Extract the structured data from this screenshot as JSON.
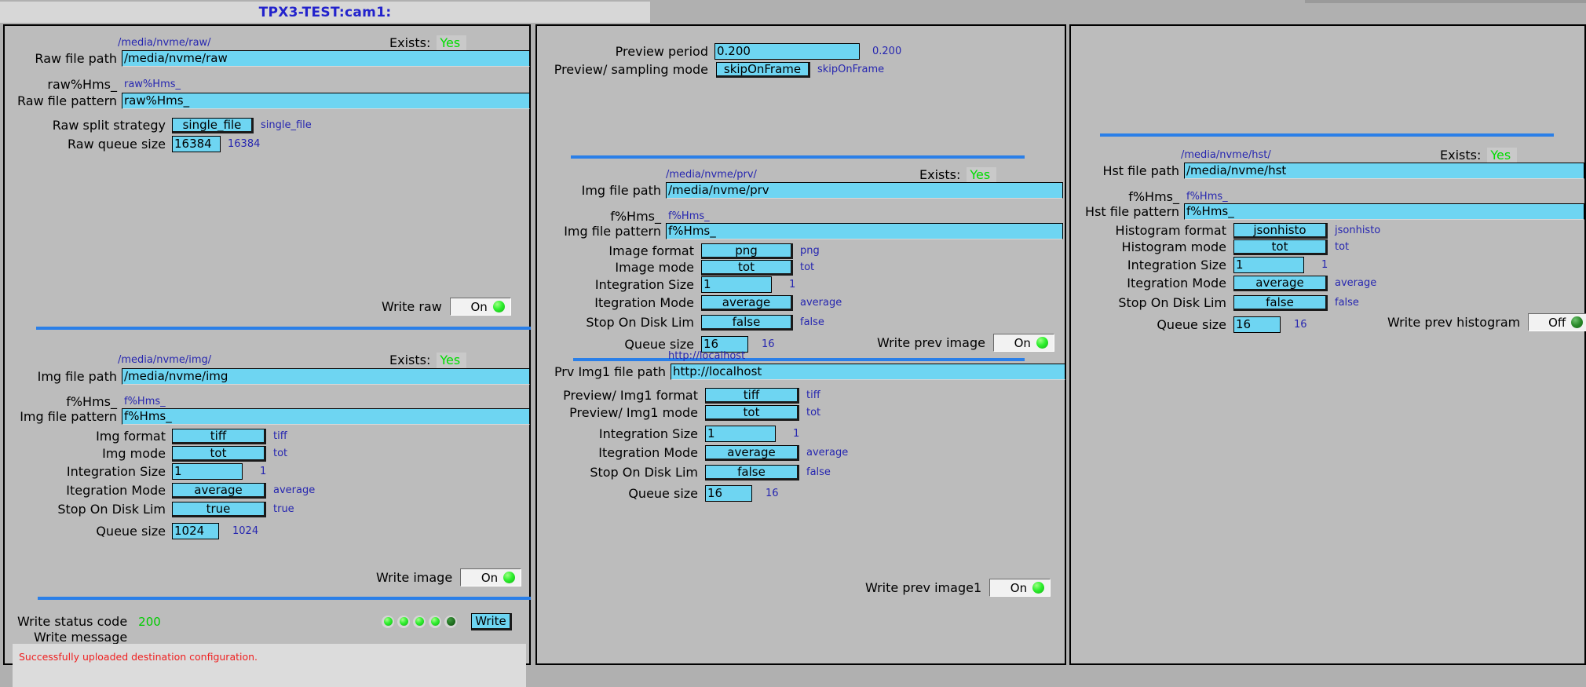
{
  "window": {
    "title": "TPX3-TEST:cam1:"
  },
  "raw_panel": {
    "raw_section": {
      "path_hint": "/media/nvme/raw/",
      "exists_label": "Exists:",
      "exists_value": "Yes",
      "file_path_label": "Raw file path",
      "file_path_value": "/media/nvme/raw",
      "pattern_hint_label": "raw%Hms_",
      "pattern_hint_echo": "raw%Hms_",
      "pattern_label": "Raw file pattern",
      "pattern_value": "raw%Hms_",
      "split_label": "Raw split strategy",
      "split_value": "single_file",
      "split_echo": "single_file",
      "queue_label": "Raw queue size",
      "queue_value": "16384",
      "queue_echo": "16384",
      "write_label": "Write raw",
      "write_state": "On"
    },
    "img_section": {
      "path_hint": "/media/nvme/img/",
      "exists_label": "Exists:",
      "exists_value": "Yes",
      "file_path_label": "Img file path",
      "file_path_value": "/media/nvme/img",
      "pattern_hint_label": "f%Hms_",
      "pattern_hint_echo": "f%Hms_",
      "pattern_label": "Img file pattern",
      "pattern_value": "f%Hms_",
      "format_label": "Img format",
      "format_value": "tiff",
      "format_echo": "tiff",
      "mode_label": "Img mode",
      "mode_value": "tot",
      "mode_echo": "tot",
      "integration_size_label": "Integration Size",
      "integration_size_value": "1",
      "integration_size_echo": "1",
      "integration_mode_label": "Itegration Mode",
      "integration_mode_value": "average",
      "integration_mode_echo": "average",
      "stop_label": "Stop On Disk Lim",
      "stop_value": "true",
      "stop_echo": "true",
      "queue_label": "Queue size",
      "queue_value": "1024",
      "queue_echo": "1024",
      "write_label": "Write image",
      "write_state": "On"
    },
    "status": {
      "code_label": "Write status code",
      "code_value": "200",
      "message_label": "Write message",
      "message_value": "Successfully uploaded destination configuration.",
      "leds": [
        "bright",
        "bright",
        "bright",
        "bright",
        "dim"
      ],
      "write_button": "Write"
    }
  },
  "prv_panel": {
    "preview": {
      "period_label": "Preview period",
      "period_value": "0.200",
      "period_echo": "0.200",
      "sampling_label": "Preview/ sampling mode",
      "sampling_value": "skipOnFrame",
      "sampling_echo": "skipOnFrame"
    },
    "img_section": {
      "path_hint": "/media/nvme/prv/",
      "exists_label": "Exists:",
      "exists_value": "Yes",
      "file_path_label": "Img file path",
      "file_path_value": "/media/nvme/prv",
      "pattern_hint_label": "f%Hms_",
      "pattern_hint_echo": "f%Hms_",
      "pattern_label": "Img file pattern",
      "pattern_value": "f%Hms_",
      "format_label": "Image format",
      "format_value": "png",
      "format_echo": "png",
      "mode_label": "Image mode",
      "mode_value": "tot",
      "mode_echo": "tot",
      "integration_size_label": "Integration Size",
      "integration_size_value": "1",
      "integration_size_echo": "1",
      "integration_mode_label": "Itegration Mode",
      "integration_mode_value": "average",
      "integration_mode_echo": "average",
      "stop_label": "Stop On Disk Lim",
      "stop_value": "false",
      "stop_echo": "false",
      "queue_label": "Queue size",
      "queue_value": "16",
      "queue_echo": "16",
      "write_label": "Write prev image",
      "write_state": "On"
    },
    "img1_section": {
      "path_hint": "http://localhost",
      "file_path_label": "Prv Img1 file path",
      "file_path_value": "http://localhost",
      "format_label": "Preview/ Img1 format",
      "format_value": "tiff",
      "format_echo": "tiff",
      "mode_label": "Preview/ Img1 mode",
      "mode_value": "tot",
      "mode_echo": "tot",
      "integration_size_label": "Integration Size",
      "integration_size_value": "1",
      "integration_size_echo": "1",
      "integration_mode_label": "Itegration Mode",
      "integration_mode_value": "average",
      "integration_mode_echo": "average",
      "stop_label": "Stop On Disk Lim",
      "stop_value": "false",
      "stop_echo": "false",
      "queue_label": "Queue size",
      "queue_value": "16",
      "queue_echo": "16",
      "write_label": "Write prev image1",
      "write_state": "On"
    }
  },
  "hst_panel": {
    "hst_section": {
      "path_hint": "/media/nvme/hst/",
      "exists_label": "Exists:",
      "exists_value": "Yes",
      "file_path_label": "Hst file path",
      "file_path_value": "/media/nvme/hst",
      "pattern_hint_label": "f%Hms_",
      "pattern_hint_echo": "f%Hms_",
      "pattern_label": "Hst file pattern",
      "pattern_value": "f%Hms_",
      "format_label": "Histogram format",
      "format_value": "jsonhisto",
      "format_echo": "jsonhisto",
      "mode_label": "Histogram mode",
      "mode_value": "tot",
      "mode_echo": "tot",
      "integration_size_label": "Integration Size",
      "integration_size_value": "1",
      "integration_size_echo": "1",
      "integration_mode_label": "Itegration Mode",
      "integration_mode_value": "average",
      "integration_mode_echo": "average",
      "stop_label": "Stop On Disk Lim",
      "stop_value": "false",
      "stop_echo": "false",
      "queue_label": "Queue size",
      "queue_value": "16",
      "queue_echo": "16",
      "write_label": "Write prev histogram",
      "write_state": "Off"
    }
  },
  "colors": {
    "accent_blue": "#2a7fe8",
    "field_cyan": "#6ed5f2",
    "echo_blue": "#2626b0",
    "ok_green": "#00dd00",
    "error_red": "#ef2020",
    "panel_gray": "#bcbcbc"
  }
}
